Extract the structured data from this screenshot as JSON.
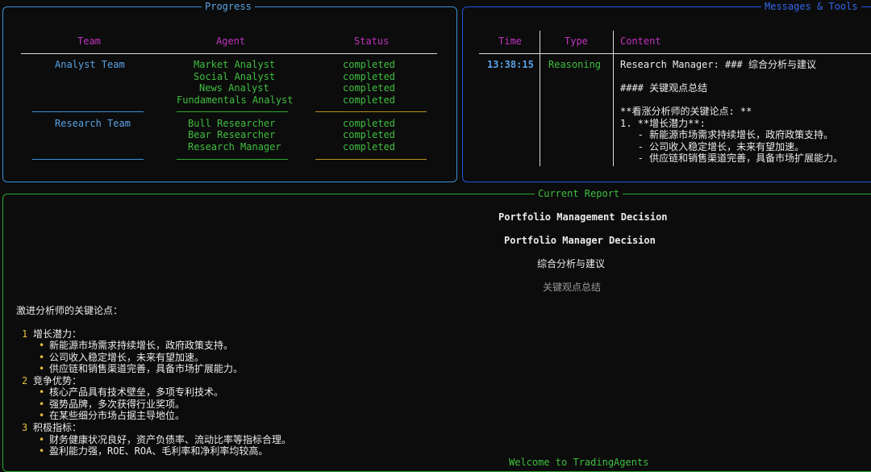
{
  "progress": {
    "title": "Progress",
    "headers": {
      "team": "Team",
      "agent": "Agent",
      "status": "Status"
    },
    "groups": [
      {
        "team": "Analyst Team",
        "agents": [
          {
            "name": "Market Analyst",
            "status": "completed"
          },
          {
            "name": "Social Analyst",
            "status": "completed"
          },
          {
            "name": "News Analyst",
            "status": "completed"
          },
          {
            "name": "Fundamentals Analyst",
            "status": "completed"
          }
        ]
      },
      {
        "team": "Research Team",
        "agents": [
          {
            "name": "Bull Researcher",
            "status": "completed"
          },
          {
            "name": "Bear Researcher",
            "status": "completed"
          },
          {
            "name": "Research Manager",
            "status": "completed"
          }
        ]
      }
    ]
  },
  "messages": {
    "title": "Messages & Tools",
    "headers": {
      "time": "Time",
      "type": "Type",
      "content": "Content"
    },
    "row": {
      "time": "13:38:15",
      "type": "Reasoning",
      "content_lines": [
        "Research Manager: ### 综合分析与建议",
        "",
        "#### 关键观点总结",
        "",
        "**看涨分析师的关键论点: **",
        "1. **增长潜力**:",
        "   - 新能源市场需求持续增长，政府政策支持。",
        "   - 公司收入稳定增长，未来有望加速。",
        "   - 供应链和销售渠道完善，具备市场扩展能力。"
      ]
    }
  },
  "report": {
    "title": "Current Report",
    "heading1": "Portfolio Management Decision",
    "heading2": "Portfolio Manager Decision",
    "heading3": "综合分析与建议",
    "heading4": "关键观点总结",
    "intro": "激进分析师的关键论点：",
    "items": [
      {
        "num": "1",
        "title": "增长潜力：",
        "bullets": [
          "新能源市场需求持续增长，政府政策支持。",
          "公司收入稳定增长，未来有望加速。",
          "供应链和销售渠道完善，具备市场扩展能力。"
        ]
      },
      {
        "num": "2",
        "title": "竞争优势：",
        "bullets": [
          "核心产品具有技术壁垒，多项专利技术。",
          "强势品牌，多次获得行业奖项。",
          "在某些细分市场占据主导地位。"
        ]
      },
      {
        "num": "3",
        "title": "积极指标：",
        "bullets": [
          "财务健康状况良好，资产负债率、流动比率等指标合理。",
          "盈利能力强，ROE、ROA、毛利率和净利率均较高。"
        ]
      }
    ],
    "bottom_text": "Welcome to TradingAgents"
  },
  "colors": {
    "progress_border": "#3a8fd6",
    "messages_border": "#2255e0",
    "report_border": "#2eaa2e"
  }
}
